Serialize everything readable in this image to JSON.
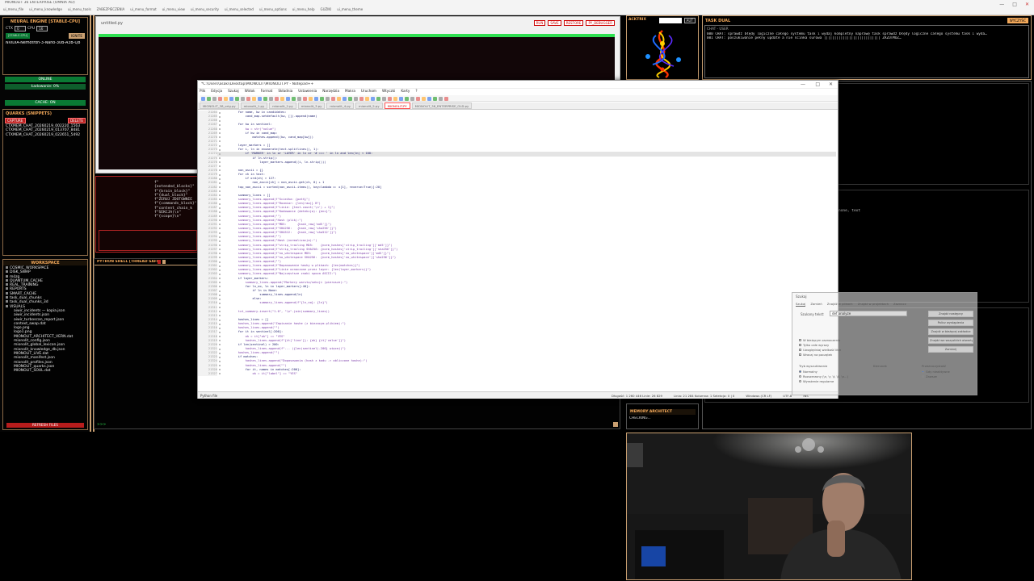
{
  "topbar": {
    "title": "MIONOLIT 36 ENTERPRISE (OMNIA AO)",
    "menu": [
      "ui_menu_file",
      "ui_menu_knowledge",
      "ui_menu_tools",
      "ZABEZPIECZENIA",
      "ui_menu_format",
      "ui_menu_view",
      "ui_menu_security",
      "ui_menu_selected",
      "ui_menu_options",
      "ui_menu_help",
      "GUZIKI",
      "ui_menu_theme"
    ]
  },
  "left": {
    "neural_title": "NEURAL ENGINE [STABLE-CPU]",
    "ctx": "CTX",
    "ctx_val": "0",
    "cpu": "CPU",
    "cpu_val": "16",
    "stable_cpu": "[STABLE-CPU]",
    "ignite": "IGNITE",
    "model": "NVIDIA-Nemotron-3-Nano-30B-A3B-Q8",
    "online": "ONLINE",
    "loading": "Ładowanie: 0%",
    "cache": "CACHE: ON",
    "quarks_title": "QUARKS (SNIPPETS)",
    "capture": "CAPTURE",
    "delete": "DELETE",
    "quarks": [
      "CTXMEM_CHAT_20260219_002220_1563",
      "CTXMEM_CHAT_20260219_013707_8481",
      "CTXMEM_CHAT_20260219_022651_5492"
    ],
    "workspace_title": "WORKSPACE",
    "workspace": [
      "COSMIC_WORKSPACE",
      "DISK_SWAP",
      "mózg",
      "QUANTUM_CACHE",
      "REAL_TRAINING",
      "REPORTS",
      "SMART_CACHE",
      "task_dual_chunks",
      "task_dual_chunks_3d",
      "VISUALS",
      "aiwir_incidents — kopia.json",
      "aiwir_incidents.json",
      "aiwir_turboscan_report.json",
      "context_swap.dat",
      "logo.png",
      "logo1.png",
      "MIONOLIT_ARCHITECT_VERN.dat",
      "mionolit_config.json",
      "mionolit_global_lexicon.json",
      "mionolit_knowledge_db.json",
      "MIONOLIT_LIVE.dat",
      "mionolit_manifest.json",
      "mionolit_profiles.json",
      "MIONOLIT_quarks.json",
      "MIONOLIT_SOUL.dat"
    ],
    "refresh": "REFRESH FILES"
  },
  "editor": {
    "file": "untitled.py",
    "buttons": [
      "RUN",
      "SAVE",
      "RESTORE",
      "PY_DEBUGGER"
    ],
    "tokens": [
      "f\"{extended_blocks}\"",
      "f\"{brain_block}\"",
      "f\"{dual_block}\"",
      "f\"ZERUJ ZDOTOWNIE",
      "f\"{commands_block}\"",
      "f\"content_chain_k",
      "f\"SEKCJA(\\n\"",
      "f\"{scope}\\n\""
    ],
    "shell_title": "PYTHON SHELL [THREAD SAFE]",
    "prompt": ">>>"
  },
  "acktrix": {
    "title": "ACKTRIX",
    "button": "AUT"
  },
  "taskdual": {
    "title": "TASK DUAL",
    "clear": "WYCZYŚĆ",
    "tab": "CHAT - USER",
    "lines": [
      "000 CHAT: sprawdź błędy logiczne całego systemu task i wydaj kompletny naprawę task sprawdź błędy logiczne całego systemu task i wyda…",
      "001 CHAT: poszukiwanie pełny update a nie ścinka surowa ||||||||||||||||||||||||||| ZRZUTMOŻ…"
    ]
  },
  "right": {
    "snippet": "none, text"
  },
  "memarch": {
    "title": "MEMORY ARCHITECT",
    "status": "CHECKING..."
  },
  "notepad": {
    "title": "*C:\\Users\\asaki\\Desktop\\MIONOLIT\\MIONOLIT.PY - Notepad++",
    "menu": [
      "Plik",
      "Edycja",
      "Szukaj",
      "Widok",
      "Format",
      "Składnia",
      "Ustawienia",
      "Narzędzia",
      "Makra",
      "Uruchom",
      "Wtyczki",
      "Karty",
      "?"
    ],
    "tabs": [
      "MIONOLIT_38_orig.py",
      "mionolit_1.py",
      "mionolit_2.py",
      "mionolit_3.py",
      "mionolit_4.py",
      "mionolit_5.py",
      "MIONOLIT.PY",
      "MIONOLIT_36_ENTERPRISE_OLD.py"
    ],
    "active_tab": 6,
    "status_left": "Python file",
    "status_right": [
      "Długość: 1 260 446   Linie: 26 829",
      "Linia: 21 284   Kolumna: 1   Selekcja: 0 | 0",
      "Windows (CR LF)",
      "UTF-8",
      "INS"
    ],
    "code": [
      [
        "21264",
        "        for name, kw in candidates:"
      ],
      [
        "21265",
        "            cand_map.setdefault(kw, []).append(name)"
      ],
      [
        "21266",
        ""
      ],
      [
        "21267",
        "        for kw in sentinel:"
      ],
      [
        "21268",
        "            kw = str(\"value\")"
      ],
      [
        "21269",
        "            if kw in cand_map:"
      ],
      [
        "21270",
        "                matches.append((kw, cand_map[kw]))"
      ],
      [
        "21271",
        ""
      ],
      [
        "21272",
        "        layer_markers = []"
      ],
      [
        "21273",
        "        for i, ln in enumerate(text.splitlines(), 1):"
      ],
      [
        "21274",
        "            if 'MARKER' in ln or 'LAYER' in ln or '# === ' in ln and len(ln) < 100:"
      ],
      [
        "21275",
        "                if ln.strip():"
      ],
      [
        "21276",
        "                    layer_markers.append((i, ln.strip()))"
      ],
      [
        "21277",
        ""
      ],
      [
        "21278",
        "        non_ascii = {}"
      ],
      [
        "21279",
        "        for ch in text:"
      ],
      [
        "21280",
        "            if ord(ch) > 127:"
      ],
      [
        "21281",
        "                non_ascii[ch] = non_ascii.get(ch, 0) + 1"
      ],
      [
        "21282",
        "        top_non_ascii = sorted(non_ascii.items(), key=lambda x: x[1], reverse=True)[:20]"
      ],
      [
        "21283",
        ""
      ],
      [
        "21284",
        "        summary_lines = []"
      ],
      [
        "21285",
        "        summary_lines.append(f\"Ścieżka: {path}\")"
      ],
      [
        "21286",
        "        summary_lines.append(f\"Rozmiar: {len(raw)} B\")"
      ],
      [
        "21287",
        "        summary_lines.append(f\"Linie: {text.count('\\n') + 1}\")"
      ],
      [
        "21288",
        "        summary_lines.append(f\"Kodowanie (detekcja): {enc}\")"
      ],
      [
        "21289",
        "        summary_lines.append(\"\")"
      ],
      [
        "21290",
        "        summary_lines.append(\"Hash (plik):\")"
      ],
      [
        "21291",
        "        summary_lines.append(f\"MD5:      {hash_raw['md5']}\")"
      ],
      [
        "21292",
        "        summary_lines.append(f\"SHA256:   {hash_raw['sha256']}\")"
      ],
      [
        "21293",
        "        summary_lines.append(f\"SHA512:   {hash_raw['sha512']}\")"
      ],
      [
        "21294",
        "        summary_lines.append(\"\")"
      ],
      [
        "21295",
        "        summary_lines.append(\"Hash (normalizacja):\")"
      ],
      [
        "21296",
        "        summary_lines.append(f\"strip_trailing MD5:    {norm_hashes['strip_trailing']['md5']}\")"
      ],
      [
        "21297",
        "        summary_lines.append(f\"strip_trailing SHA256: {norm_hashes['strip_trailing']['sha256']}\")"
      ],
      [
        "21298",
        "        summary_lines.append(f\"no_whitespace MD5:     {norm_hashes['no_whitespace']['md5']}\")"
      ],
      [
        "21299",
        "        summary_lines.append(f\"no_whitespace SHA256:  {norm_hashes['no_whitespace']['sha256']}\")"
      ],
      [
        "21300",
        "        summary_lines.append(\"\")"
      ],
      [
        "21301",
        "        summary_lines.append(f\"Dopasowanie hashy w plikach: {len(matches)}\")"
      ],
      [
        "21302",
        "        summary_lines.append(f\"Linie oznaczone przez layer: {len(layer_markers)}\")"
      ],
      [
        "21303",
        "        summary_lines.append(f\"Najczęstsze znaki spoza ASCII:\")"
      ],
      [
        "21304",
        "        if layer_markers:"
      ],
      [
        "21305",
        "            summary_lines.append(\"Markery warstw/sekcji (pierwsze):\")"
      ],
      [
        "21306",
        "            for ln_no, ln in layer_markers[:40]:"
      ],
      [
        "21307",
        "                if ln is None:"
      ],
      [
        "21308",
        "                    summary_lines.append(ln)"
      ],
      [
        "21309",
        "                else:"
      ],
      [
        "21310",
        "                    summary_lines.append(f\"{ln_no}: {ln}\")"
      ],
      [
        "21311",
        ""
      ],
      [
        "21312",
        "        txt_summary.insert(\"1.0\", \"\\n\".join(summary_lines))"
      ],
      [
        "21313",
        ""
      ],
      [
        "21314",
        "        hashes_lines = []"
      ],
      [
        "21315",
        "        hashes_lines.append(\"Zapisanie hashe (z biezacym plikiem):\")"
      ],
      [
        "21316",
        "        hashes_lines.append(\"\")"
      ],
      [
        "21317",
        "        for it in sentinel[:200]:"
      ],
      [
        "21318",
        "            ok = it[\"ok\"] == \"YES\""
      ],
      [
        "21319",
        "            hashes_lines.append(f\"{it['line']}: {ok} {it['value']}\")"
      ],
      [
        "21320",
        "        if len(sentinel) > 200:"
      ],
      [
        "21321",
        "            hashes_lines.append(f\"... ({len(sentinel)-200} więcej)\")"
      ],
      [
        "21322",
        "        hashes_lines.append(\"\")"
      ],
      [
        "21323",
        "        if matches:"
      ],
      [
        "21324",
        "            hashes_lines.append(\"Dopasowania (hash z kodu -> obliczone hashe):\")"
      ],
      [
        "21325",
        "            hashes_lines.append(\"\")"
      ],
      [
        "21326",
        "            for it, names in matches[:200]:"
      ],
      [
        "21327",
        "                ok = it[\"label\"] == \"YES\""
      ]
    ]
  },
  "dialog": {
    "title": "Szukaj",
    "tabs": [
      "Szukaj",
      "Zamień",
      "Znajdź w plikach",
      "Znajdź w projektach",
      "Zaznacz"
    ],
    "field_label": "Szukany tekst:",
    "field_value": "def analyze",
    "buttons": [
      "Znajdź następny",
      "Policz wystąpienia",
      "Znajdź w bieżącej zakładce",
      "Znajdź we wszystkich otwartych plikach",
      "Zamknij"
    ],
    "options": [
      "W bieżącym zaznaczeniu",
      "Tylko całe wyrazy",
      "Uwzględniaj wielkość liter",
      "Wracaj na początek"
    ],
    "mode_title": "Tryb wyszukiwania",
    "modes": [
      "Normalny",
      "Rozszerzony (\\n, \\r, \\t, \\0, \\x...)",
      "Wyrażenie regularne"
    ],
    "direction_title": "Kierunek",
    "transparency": "Przezroczystość",
    "trans_opts": [
      "Gdy nieaktywne",
      "Zawsze"
    ]
  },
  "colors": {
    "accent": "#caa072",
    "green": "#2fe051",
    "red": "#b71c1c",
    "orange": "#f2a85a"
  }
}
